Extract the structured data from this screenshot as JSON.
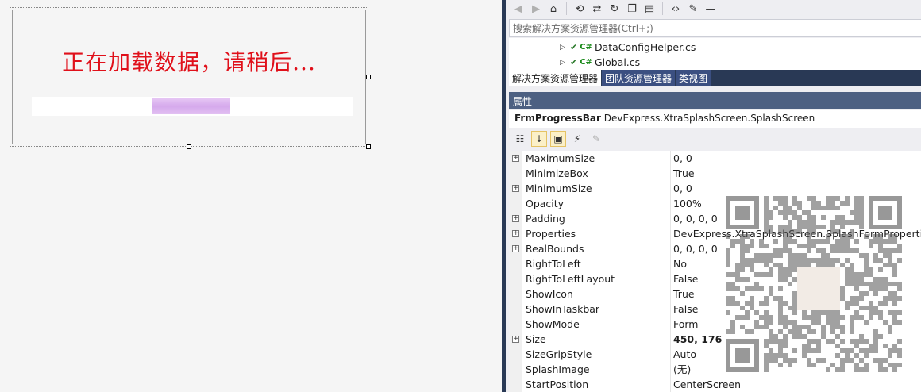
{
  "designer": {
    "loading_text": "正在加载数据，请稍后...",
    "progress_style": "marquee"
  },
  "solution_explorer": {
    "search_placeholder": "搜索解决方案资源管理器(Ctrl+;)",
    "tree": [
      {
        "label": "DataConfigHelper.cs"
      },
      {
        "label": "Global.cs"
      }
    ],
    "tabs": [
      {
        "label": "解决方案资源管理器",
        "active": true
      },
      {
        "label": "团队资源管理器",
        "active": false
      },
      {
        "label": "类视图",
        "active": false
      }
    ]
  },
  "properties": {
    "title": "属性",
    "object_name": "FrmProgressBar",
    "object_type": "DevExpress.XtraSplashScreen.SplashScreen",
    "rows": [
      {
        "name": "MaximumSize",
        "value": "0, 0",
        "expandable": true,
        "bold": false
      },
      {
        "name": "MinimizeBox",
        "value": "True",
        "expandable": false,
        "bold": false
      },
      {
        "name": "MinimumSize",
        "value": "0, 0",
        "expandable": true,
        "bold": false
      },
      {
        "name": "Opacity",
        "value": "100%",
        "expandable": false,
        "bold": false
      },
      {
        "name": "Padding",
        "value": "0, 0, 0, 0",
        "expandable": true,
        "bold": false
      },
      {
        "name": "Properties",
        "value": "DevExpress.XtraSplashScreen.SplashFormProperties",
        "expandable": true,
        "bold": false
      },
      {
        "name": "RealBounds",
        "value": "0, 0, 0, 0",
        "expandable": true,
        "bold": false
      },
      {
        "name": "RightToLeft",
        "value": "No",
        "expandable": false,
        "bold": false
      },
      {
        "name": "RightToLeftLayout",
        "value": "False",
        "expandable": false,
        "bold": false
      },
      {
        "name": "ShowIcon",
        "value": "True",
        "expandable": false,
        "bold": false
      },
      {
        "name": "ShowInTaskbar",
        "value": "False",
        "expandable": false,
        "bold": false
      },
      {
        "name": "ShowMode",
        "value": "Form",
        "expandable": false,
        "bold": false
      },
      {
        "name": "Size",
        "value": "450, 176",
        "expandable": true,
        "bold": true
      },
      {
        "name": "SizeGripStyle",
        "value": "Auto",
        "expandable": false,
        "bold": false
      },
      {
        "name": "SplashImage",
        "value": "(无)",
        "expandable": false,
        "bold": false
      },
      {
        "name": "StartPosition",
        "value": "CenterScreen",
        "expandable": false,
        "bold": false
      }
    ]
  },
  "toolbar_icons": [
    "back-icon",
    "forward-icon",
    "home-icon",
    "history-icon",
    "sync-icon",
    "refresh-icon",
    "collapse-all-icon",
    "show-all-files-icon",
    "view-code-icon",
    "properties-icon",
    "pin-icon"
  ],
  "colors": {
    "loading_text": "#e0101a",
    "progress": "#d5a9ec",
    "panel_dark": "#293955",
    "props_header": "#4d6082"
  }
}
